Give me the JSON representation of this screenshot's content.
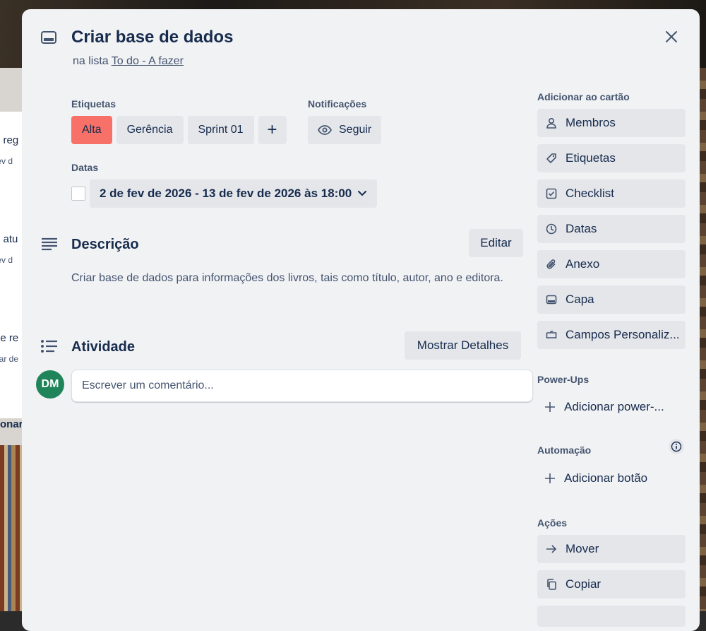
{
  "background": {
    "cards": [
      {
        "title": "e reg",
        "sub": "fev d"
      },
      {
        "title": "e atu",
        "sub": "fev d"
      },
      {
        "title": "de re",
        "sub": "nar de"
      }
    ],
    "footer_text": "onar"
  },
  "card": {
    "title": "Criar base de dados",
    "in_list_prefix": "na lista",
    "list_name": "To do - A fazer"
  },
  "labels": {
    "heading": "Etiquetas",
    "items": [
      "Alta",
      "Gerência",
      "Sprint 01"
    ],
    "add": "+"
  },
  "notifications": {
    "heading": "Notificações",
    "follow_label": "Seguir"
  },
  "dates": {
    "heading": "Datas",
    "value": "2 de fev de 2026 - 13 de fev de 2026 às 18:00"
  },
  "description": {
    "heading": "Descrição",
    "edit_label": "Editar",
    "text": "Criar base de dados para informações dos livros, tais como título, autor, ano e editora."
  },
  "activity": {
    "heading": "Atividade",
    "details_label": "Mostrar Detalhes",
    "avatar_initials": "DM",
    "comment_placeholder": "Escrever um comentário..."
  },
  "sidebar": {
    "add_to_card": "Adicionar ao cartão",
    "add_items": [
      {
        "label": "Membros",
        "icon": "person-icon"
      },
      {
        "label": "Etiquetas",
        "icon": "tag-icon"
      },
      {
        "label": "Checklist",
        "icon": "checklist-icon"
      },
      {
        "label": "Datas",
        "icon": "clock-icon"
      },
      {
        "label": "Anexo",
        "icon": "paperclip-icon"
      },
      {
        "label": "Capa",
        "icon": "cover-icon"
      },
      {
        "label": "Campos Personaliz...",
        "icon": "custom-fields-icon"
      }
    ],
    "powerups_heading": "Power-Ups",
    "add_powerup": "Adicionar power-...",
    "automation_heading": "Automação",
    "add_button": "Adicionar botão",
    "actions_heading": "Ações",
    "action_items": [
      {
        "label": "Mover",
        "icon": "arrow-right-icon"
      },
      {
        "label": "Copiar",
        "icon": "copy-icon"
      }
    ]
  },
  "colors": {
    "label_alta": "#f87168",
    "avatar": "#1f845a",
    "modal_bg": "#f1f2f4",
    "button_bg": "#e4e6ea"
  }
}
